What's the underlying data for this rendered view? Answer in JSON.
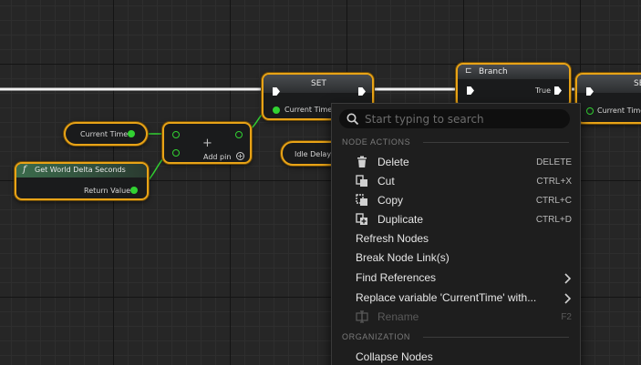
{
  "nodes": {
    "current_time_get": {
      "label": "Current Time"
    },
    "world_delta": {
      "title": "Get World Delta Seconds",
      "output_label": "Return Value"
    },
    "add": {
      "symbol": "+",
      "add_pin_label": "Add pin"
    },
    "set": {
      "title": "SET",
      "pin_label": "Current Time"
    },
    "idle_delay": {
      "label": "Idle Delay T"
    },
    "branch": {
      "title": "Branch",
      "true_label": "True"
    },
    "right_set": {
      "title": "SE",
      "pin_label": "Current Time"
    }
  },
  "menu": {
    "search_placeholder": "Start typing to search",
    "sections": {
      "node_actions": "NODE ACTIONS",
      "organization": "ORGANIZATION"
    },
    "items": [
      {
        "label": "Delete",
        "shortcut": "DELETE",
        "icon": "trash-icon"
      },
      {
        "label": "Cut",
        "shortcut": "CTRL+X",
        "icon": "cut-icon"
      },
      {
        "label": "Copy",
        "shortcut": "CTRL+C",
        "icon": "copy-icon"
      },
      {
        "label": "Duplicate",
        "shortcut": "CTRL+D",
        "icon": "duplicate-icon"
      },
      {
        "label": "Refresh Nodes"
      },
      {
        "label": "Break Node Link(s)"
      },
      {
        "label": "Find References",
        "submenu": true
      },
      {
        "label": "Replace variable 'CurrentTime' with...",
        "submenu": true
      },
      {
        "label": "Rename",
        "shortcut": "F2",
        "disabled": true,
        "icon": "rename-icon"
      },
      {
        "label": "Collapse Nodes"
      }
    ]
  },
  "colors": {
    "node_border": "#e8a317",
    "float_pin": "#32d232",
    "menu_bg": "#1e1e1e"
  }
}
